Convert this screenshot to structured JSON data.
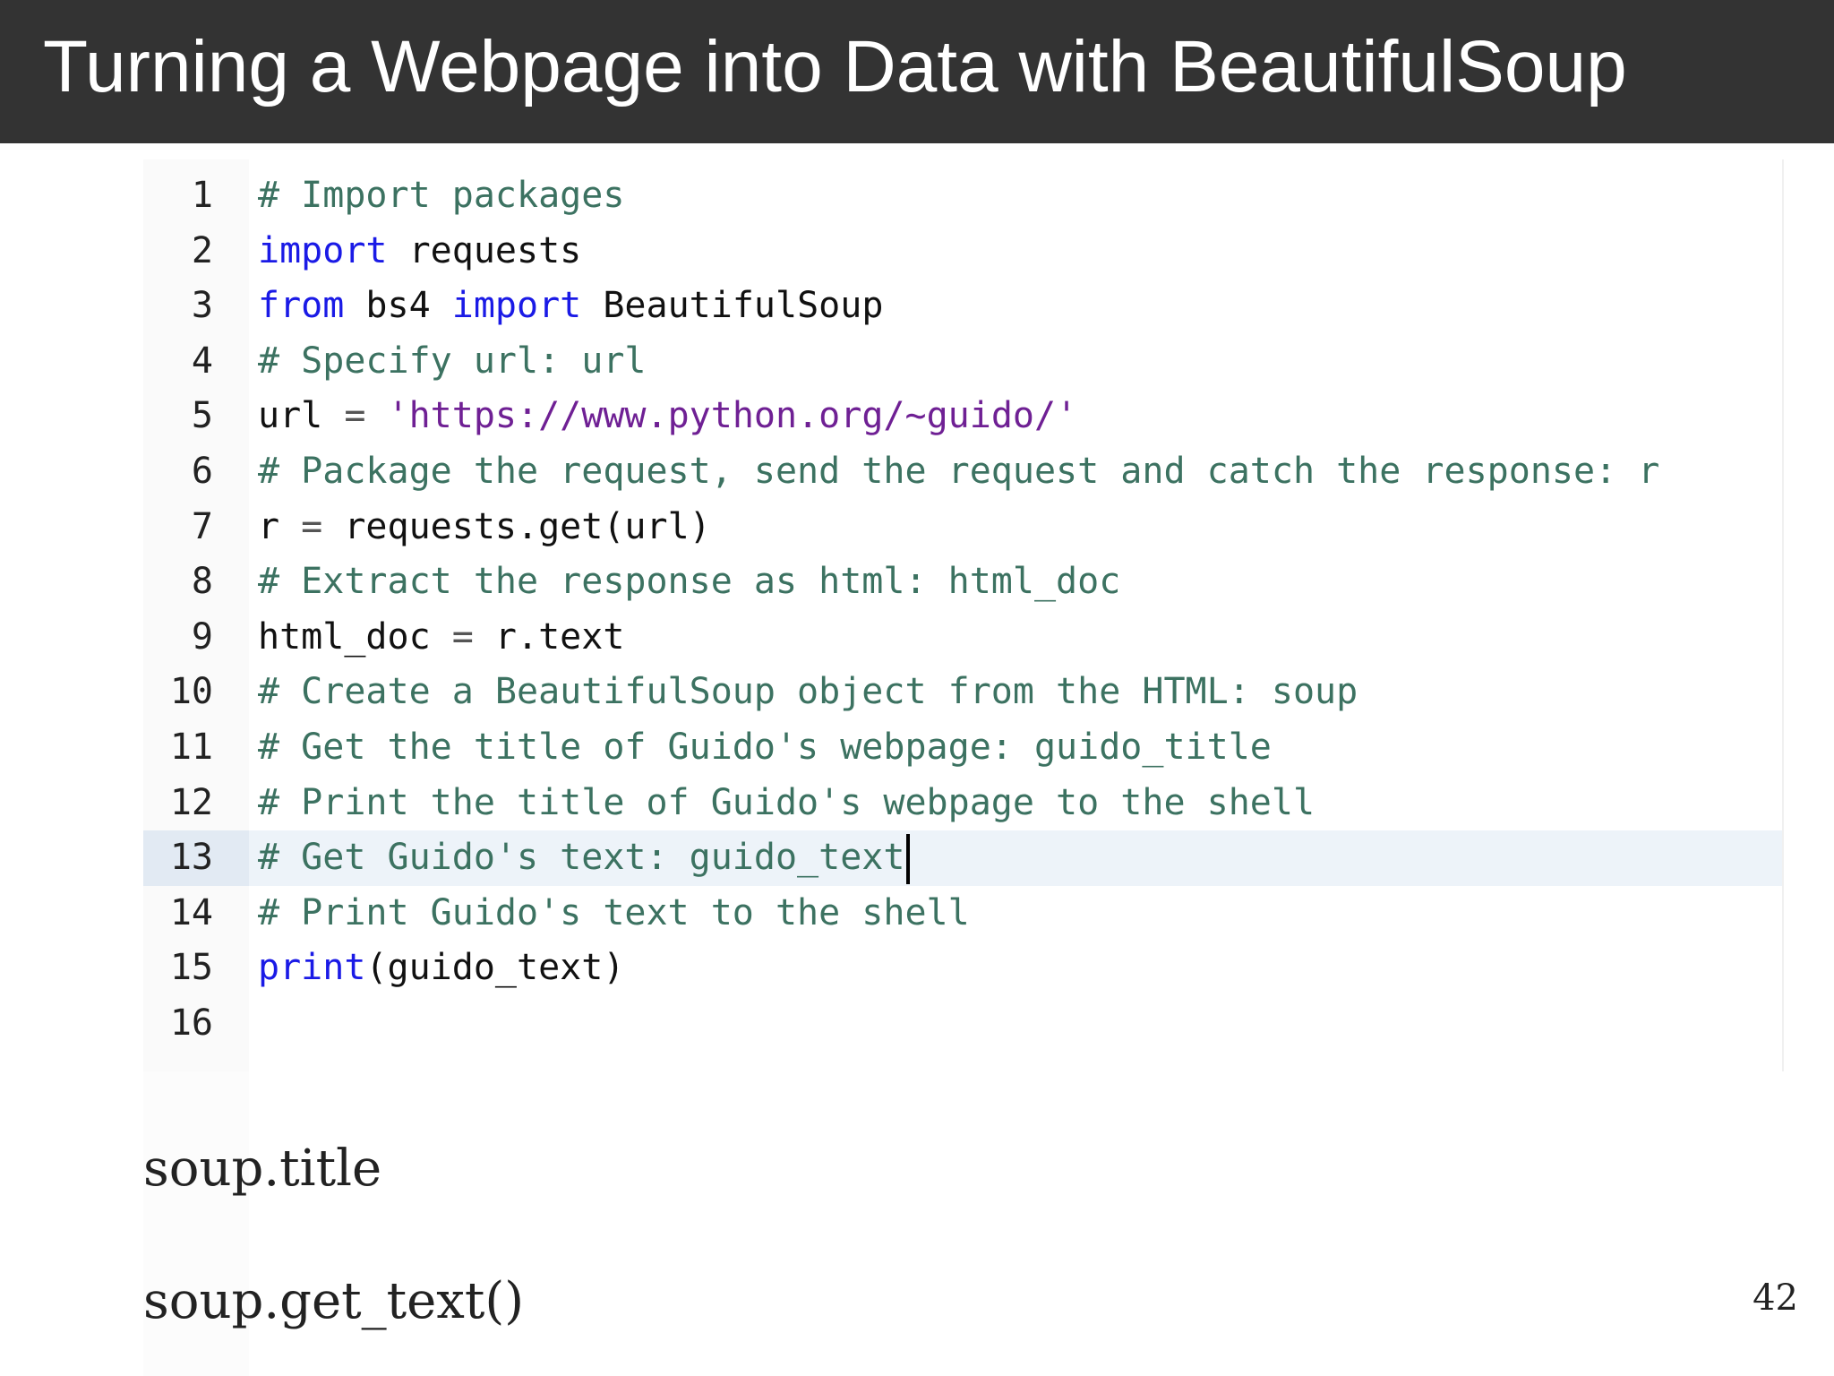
{
  "slide": {
    "title": "Turning a Webpage into Data with BeautifulSoup",
    "page_number": "42",
    "notes": [
      "soup.title",
      "soup.get_text()"
    ]
  },
  "editor": {
    "active_line": 13,
    "lines": [
      {
        "number": "1",
        "tokens": [
          {
            "type": "comment",
            "text": "# Import packages"
          }
        ]
      },
      {
        "number": "2",
        "tokens": [
          {
            "type": "keyword",
            "text": "import"
          },
          {
            "type": "plain",
            "text": " requests"
          }
        ]
      },
      {
        "number": "3",
        "tokens": [
          {
            "type": "keyword",
            "text": "from"
          },
          {
            "type": "plain",
            "text": " bs4 "
          },
          {
            "type": "keyword",
            "text": "import"
          },
          {
            "type": "plain",
            "text": " BeautifulSoup"
          }
        ]
      },
      {
        "number": "4",
        "tokens": [
          {
            "type": "comment",
            "text": "# Specify url: url"
          }
        ]
      },
      {
        "number": "5",
        "tokens": [
          {
            "type": "plain",
            "text": "url "
          },
          {
            "type": "op",
            "text": "="
          },
          {
            "type": "plain",
            "text": " "
          },
          {
            "type": "string",
            "text": "'https://www.python.org/~guido/'"
          }
        ]
      },
      {
        "number": "6",
        "tokens": [
          {
            "type": "comment",
            "text": "# Package the request, send the request and catch the response: r"
          }
        ]
      },
      {
        "number": "7",
        "tokens": [
          {
            "type": "plain",
            "text": "r "
          },
          {
            "type": "op",
            "text": "="
          },
          {
            "type": "plain",
            "text": " requests.get(url)"
          }
        ]
      },
      {
        "number": "8",
        "tokens": [
          {
            "type": "comment",
            "text": "# Extract the response as html: html_doc"
          }
        ]
      },
      {
        "number": "9",
        "tokens": [
          {
            "type": "plain",
            "text": "html_doc "
          },
          {
            "type": "op",
            "text": "="
          },
          {
            "type": "plain",
            "text": " r.text"
          }
        ]
      },
      {
        "number": "10",
        "tokens": [
          {
            "type": "comment",
            "text": "# Create a BeautifulSoup object from the HTML: soup"
          }
        ]
      },
      {
        "number": "11",
        "tokens": [
          {
            "type": "comment",
            "text": "# Get the title of Guido's webpage: guido_title"
          }
        ]
      },
      {
        "number": "12",
        "tokens": [
          {
            "type": "comment",
            "text": "# Print the title of Guido's webpage to the shell"
          }
        ]
      },
      {
        "number": "13",
        "tokens": [
          {
            "type": "comment",
            "text": "# Get Guido's text: guido_text"
          }
        ]
      },
      {
        "number": "14",
        "tokens": [
          {
            "type": "comment",
            "text": "# Print Guido's text to the shell"
          }
        ]
      },
      {
        "number": "15",
        "tokens": [
          {
            "type": "keyword",
            "text": "print"
          },
          {
            "type": "plain",
            "text": "(guido_text)"
          }
        ]
      },
      {
        "number": "16",
        "tokens": []
      }
    ]
  },
  "colors": {
    "title_bar": "#333333",
    "comment": "#3c7261",
    "keyword": "#1a1ae6",
    "string": "#6f2094",
    "active_line": "#edf3f9"
  }
}
